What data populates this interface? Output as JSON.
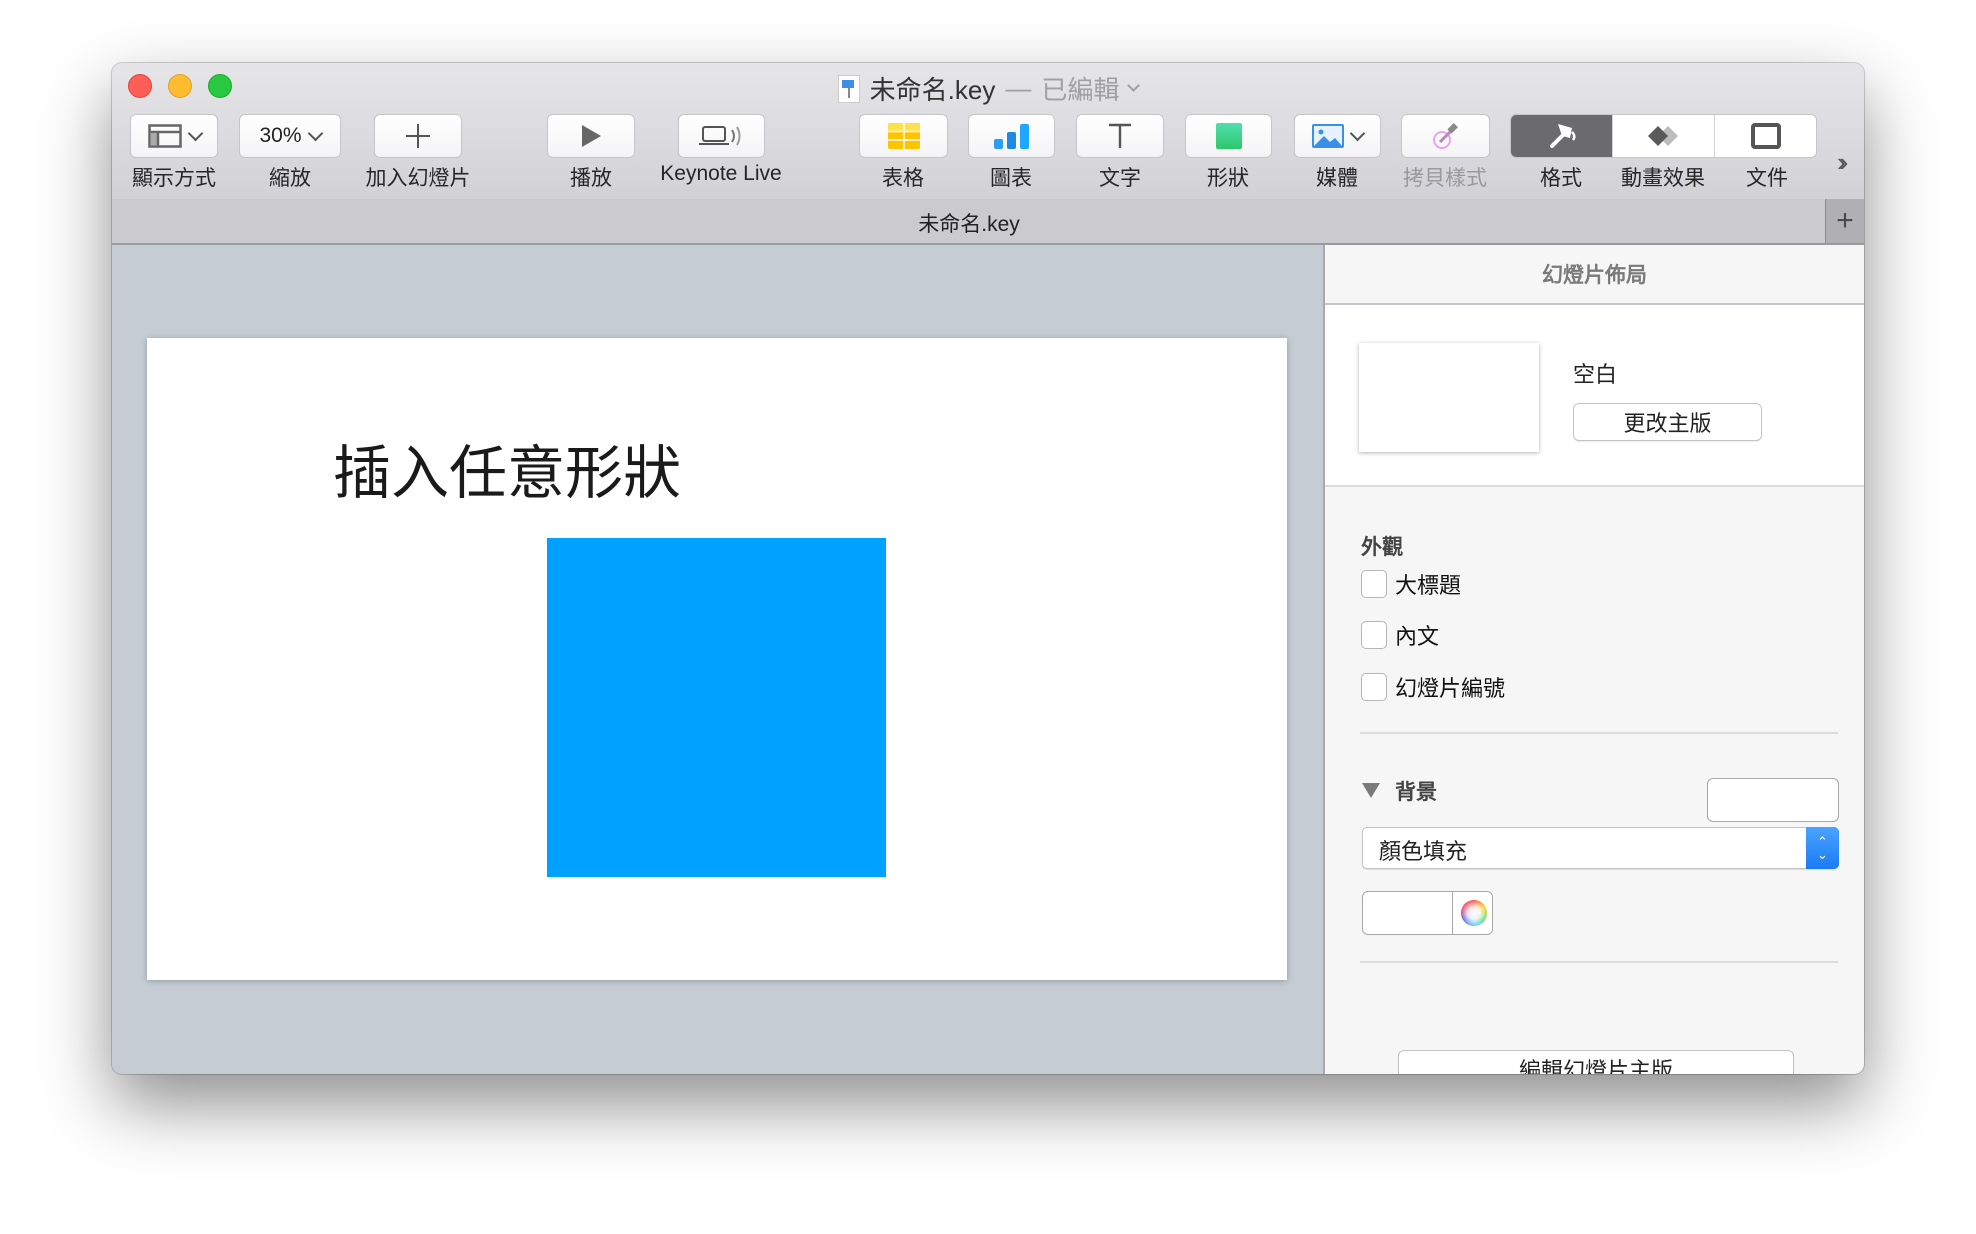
{
  "window": {
    "title": "未命名.key",
    "title_separator": "—",
    "title_status": "已編輯",
    "tab_title": "未命名.key"
  },
  "toolbar": {
    "view": {
      "label": "顯示方式",
      "icon": "sidebar-layout-icon"
    },
    "zoom": {
      "label": "縮放",
      "value": "30%"
    },
    "add_slide": {
      "label": "加入幻燈片",
      "icon": "plus-icon"
    },
    "play": {
      "label": "播放",
      "icon": "play-icon"
    },
    "keynote_live": {
      "label": "Keynote Live",
      "icon": "laptop-broadcast-icon"
    },
    "table": {
      "label": "表格",
      "icon": "table-icon",
      "color": "#FFD60A"
    },
    "chart": {
      "label": "圖表",
      "icon": "bar-chart-icon",
      "color": "#1E90FF"
    },
    "text": {
      "label": "文字",
      "icon": "text-icon"
    },
    "shape": {
      "label": "形狀",
      "icon": "square-shape-icon",
      "color": "#34C77B"
    },
    "media": {
      "label": "媒體",
      "icon": "image-icon",
      "color": "#3A8FE6"
    },
    "copy_style": {
      "label": "拷貝樣式",
      "icon": "eyedropper-icon",
      "disabled": true
    },
    "format": {
      "label": "格式",
      "icon": "paintbrush-icon",
      "active": true
    },
    "animate": {
      "label": "動畫效果",
      "icon": "diamond-animate-icon"
    },
    "document": {
      "label": "文件",
      "icon": "document-icon"
    },
    "overflow": "»"
  },
  "tab_add": "+",
  "slide": {
    "title": "插入任意形狀",
    "shape_color": "#00A2FF"
  },
  "inspector": {
    "header": "幻燈片佈局",
    "master_name": "空白",
    "change_master": "更改主版",
    "appearance_label": "外觀",
    "checkboxes": [
      {
        "label": "大標題",
        "checked": false
      },
      {
        "label": "內文",
        "checked": false
      },
      {
        "label": "幻燈片編號",
        "checked": false
      }
    ],
    "background_label": "背景",
    "fill_type": "顏色填充",
    "fill_color": "#FFFFFF",
    "edit_master": "編輯幻燈片主版"
  }
}
